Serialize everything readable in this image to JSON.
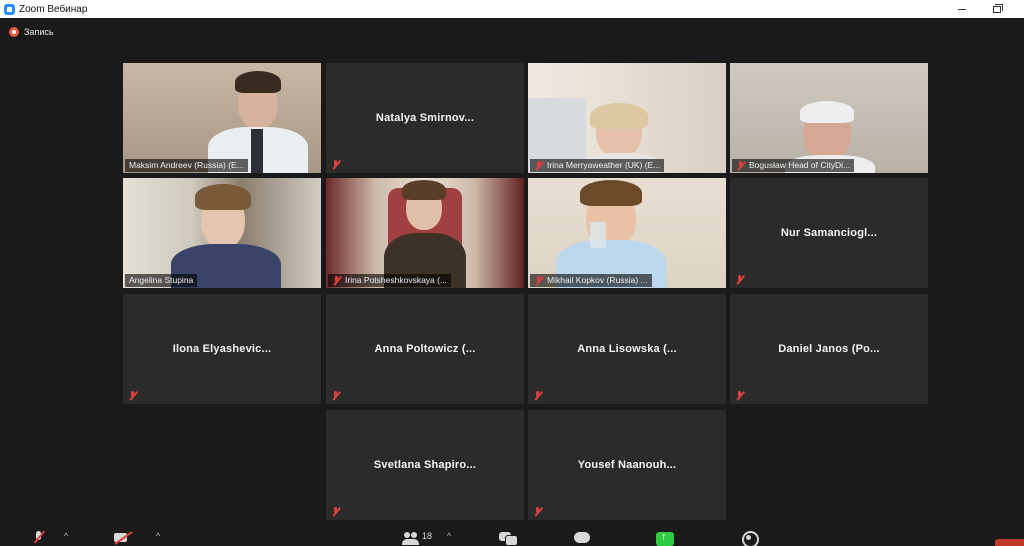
{
  "window": {
    "title": "Zoom Вебинар",
    "app_icon": "zoom-icon"
  },
  "recording": {
    "label": "Запись",
    "color": "#e25c45"
  },
  "gallery": {
    "active_speaker_color": "#c9e04a",
    "video_tiles": [
      {
        "label": "Maksim Andreev (Russia) (E...",
        "mic_muted": false
      },
      {
        "label": "Irina Merryaweather (UK) (E...",
        "mic_muted": true
      },
      {
        "label": "Bogusław Head of CityDi...",
        "mic_muted": true
      },
      {
        "label": "Angelina Stupina",
        "mic_muted": false
      },
      {
        "label": "Irina Potsheshkovskaya (...",
        "mic_muted": true
      },
      {
        "label": "Mikhail Kopkov (Russia) ...",
        "mic_muted": true
      }
    ],
    "name_tiles": [
      {
        "name": "Natalya  Smirnov..."
      },
      {
        "name": "Nur  Samanciogl..."
      },
      {
        "name": "Ilona  Elyashevic..."
      },
      {
        "name": "Anna  Poltowicz  (..."
      },
      {
        "name": "Anna  Lisowska  (..."
      },
      {
        "name": "Daniel  Janos  (Po..."
      },
      {
        "name": "Svetlana  Shapiro..."
      },
      {
        "name": "Yousef  Naanouh..."
      }
    ]
  },
  "toolbar": {
    "participants_count": "18",
    "caret": "^",
    "share_color": "#2ecc40",
    "end_color": "#c0392b"
  }
}
